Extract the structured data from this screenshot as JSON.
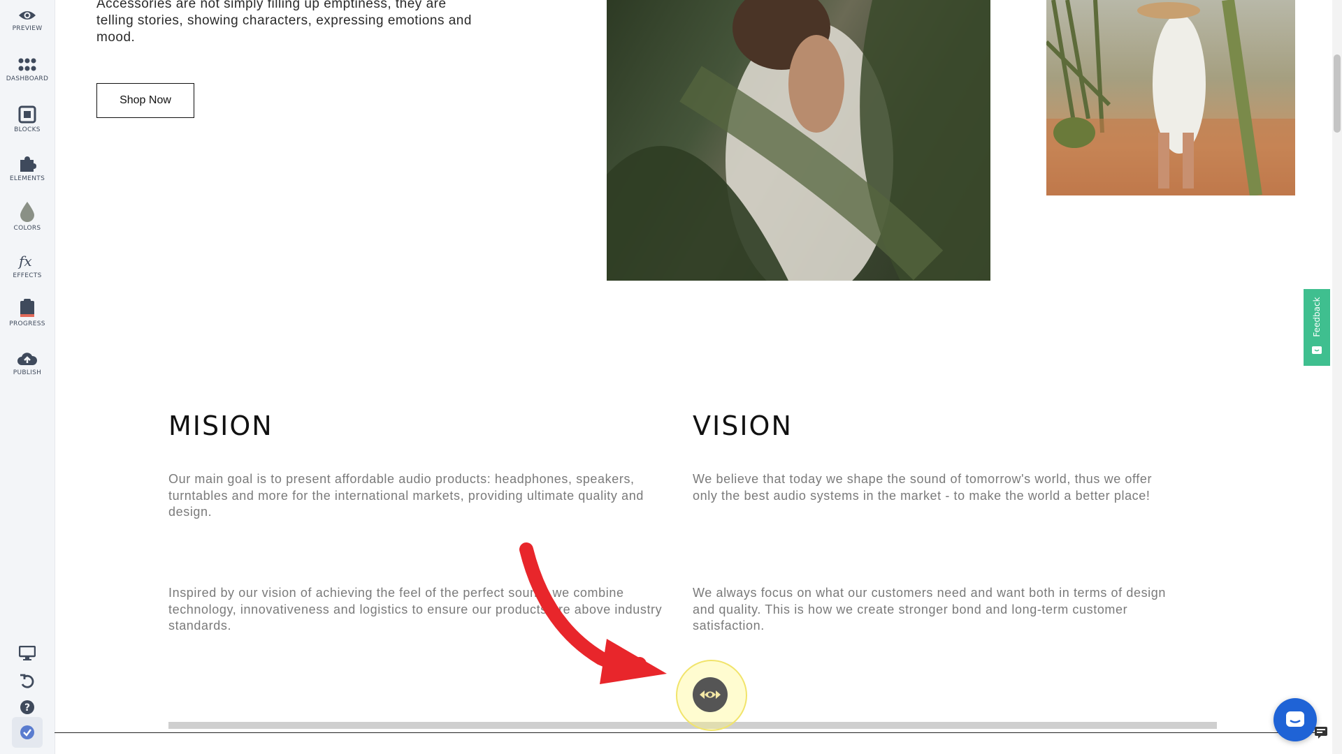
{
  "sidebar": {
    "items": [
      {
        "label": "PREVIEW",
        "icon": "eye-icon"
      },
      {
        "label": "DASHBOARD",
        "icon": "grid-dots-icon"
      },
      {
        "label": "BLOCKS",
        "icon": "blocks-icon"
      },
      {
        "label": "ELEMENTS",
        "icon": "puzzle-icon"
      },
      {
        "label": "COLORS",
        "icon": "droplet-icon"
      },
      {
        "label": "EFFECTS",
        "icon": "fx-icon"
      },
      {
        "label": "PROGRESS",
        "icon": "clipboard-icon"
      },
      {
        "label": "PUBLISH",
        "icon": "cloud-upload-icon"
      }
    ],
    "bottom_icons": [
      "desktop-icon",
      "undo-icon",
      "help-icon",
      "check-badge-icon"
    ]
  },
  "hero": {
    "text": "Accessories are not simply filling up emptiness, they are telling stories, showing characters, expressing emotions and mood.",
    "button_label": "Shop Now"
  },
  "mission": {
    "title": "MISION",
    "paragraph1": "Our main goal is to present affordable audio products: headphones, speakers, turntables and more for the international markets, providing ultimate quality and design.",
    "paragraph2": "Inspired by our vision of achieving the feel of the perfect sound, we combine technology, innovativeness and logistics to ensure our products are above industry standards."
  },
  "vision": {
    "title": "VISION",
    "paragraph1": "We believe that today we shape the sound of tomorrow's world, thus we offer only the best audio systems in the market - to make the world a better place!",
    "paragraph2": "We always focus on what our customers need and want both in terms of design and quality. This is how we create stronger bond and long-term customer satisfaction."
  },
  "feedback": {
    "label": "Feedback"
  },
  "colors": {
    "accent_feedback": "#3fbf8f",
    "chat_button": "#1f63d6",
    "tutorial_arrow": "#e8262b",
    "highlight_ring": "#f1e46b"
  }
}
